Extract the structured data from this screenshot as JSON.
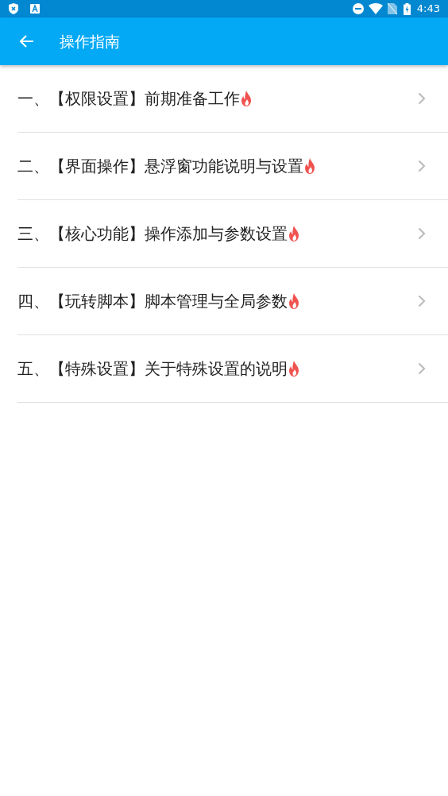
{
  "status_bar": {
    "time": "4:43"
  },
  "app_bar": {
    "title": "操作指南"
  },
  "items": [
    {
      "label": "一、【权限设置】前期准备工作",
      "hot": true
    },
    {
      "label": "二、【界面操作】悬浮窗功能说明与设置",
      "hot": true
    },
    {
      "label": "三、【核心功能】操作添加与参数设置",
      "hot": true
    },
    {
      "label": "四、【玩转脚本】脚本管理与全局参数",
      "hot": true
    },
    {
      "label": "五、【特殊设置】关于特殊设置的说明",
      "hot": true
    }
  ]
}
